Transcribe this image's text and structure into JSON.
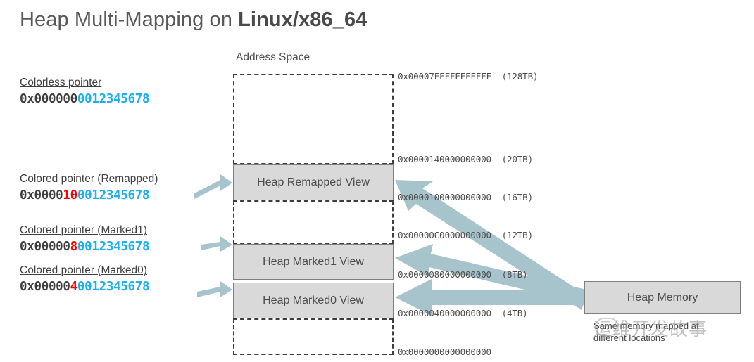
{
  "title": {
    "plain": "Heap Multi-Mapping on ",
    "strong": "Linux/x86_64"
  },
  "address_space": {
    "label": "Address Space"
  },
  "pointers": [
    {
      "caption": "Colorless pointer",
      "prefix": "0x000000",
      "color_bits": "",
      "offset": "0012345678"
    },
    {
      "caption": "Colored pointer (Remapped)",
      "prefix": "0x0000",
      "color_bits": "10",
      "offset": "0012345678"
    },
    {
      "caption": "Colored pointer (Marked1)",
      "prefix": "0x00000",
      "color_bits": "8",
      "offset": "0012345678"
    },
    {
      "caption": "Colored pointer (Marked0)",
      "prefix": "0x00000",
      "color_bits": "4",
      "offset": "0012345678"
    }
  ],
  "views": [
    {
      "label": "Heap Remapped View"
    },
    {
      "label": "Heap Marked1 View"
    },
    {
      "label": "Heap Marked0 View"
    }
  ],
  "heap_memory": {
    "label": "Heap Memory"
  },
  "addresses": [
    {
      "hex": "0x00007FFFFFFFFFFF",
      "size": "(128TB)"
    },
    {
      "hex": "0x0000140000000000",
      "size": "(20TB)"
    },
    {
      "hex": "0x0000100000000000",
      "size": "(16TB)"
    },
    {
      "hex": "0x00000C0000000000",
      "size": "(12TB)"
    },
    {
      "hex": "0x0000080000000000",
      "size": "(8TB)"
    },
    {
      "hex": "0x0000040000000000",
      "size": "(4TB)"
    },
    {
      "hex": "0x0000000000000000",
      "size": ""
    }
  ],
  "note": {
    "line1": "Same memory mapped at",
    "line2": "different locations"
  },
  "watermark": {
    "text": "运维开发故事"
  },
  "colors": {
    "arrow": "#a7c4cc",
    "box_fill": "#d9d9d9",
    "box_border": "#7f7f7f",
    "text": "#4d4d4d",
    "cyan": "#1eb0ea",
    "red": "#ff0000"
  }
}
